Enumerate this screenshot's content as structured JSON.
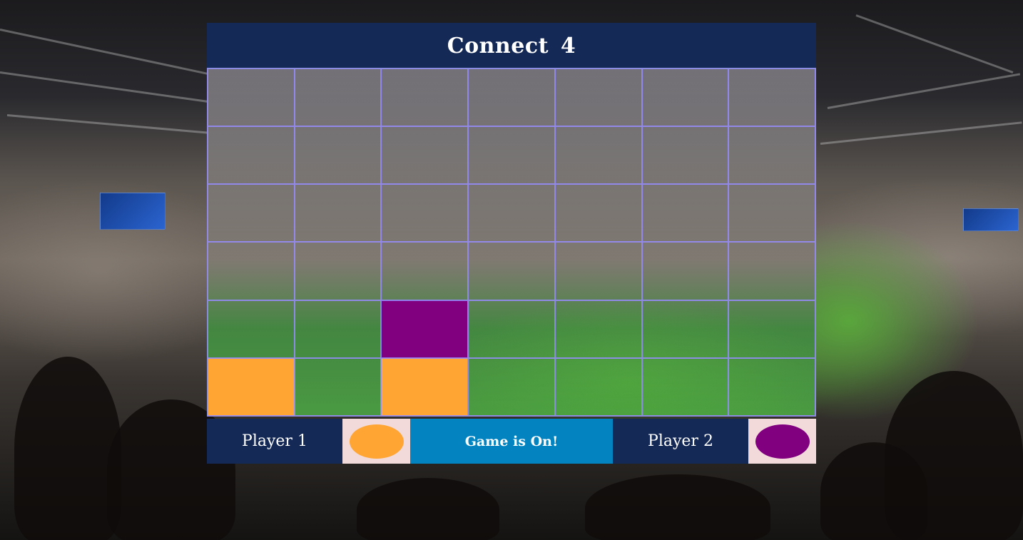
{
  "title": "Connect  4",
  "board": {
    "rows": 6,
    "cols": 7,
    "cells": [
      [
        0,
        0,
        0,
        0,
        0,
        0,
        0
      ],
      [
        0,
        0,
        0,
        0,
        0,
        0,
        0
      ],
      [
        0,
        0,
        0,
        0,
        0,
        0,
        0
      ],
      [
        0,
        0,
        0,
        0,
        0,
        0,
        0
      ],
      [
        0,
        0,
        2,
        0,
        0,
        0,
        0
      ],
      [
        1,
        0,
        1,
        0,
        0,
        0,
        0
      ]
    ]
  },
  "players": {
    "p1": {
      "label": "Player 1",
      "color": "#ffa533"
    },
    "p2": {
      "label": "Player 2",
      "color": "#800080"
    }
  },
  "status": "Game is On!",
  "colors": {
    "header": "#152956",
    "status_bg": "#0383c0",
    "grid_line": "#968cff",
    "swatch_bg": "#f2dada"
  }
}
